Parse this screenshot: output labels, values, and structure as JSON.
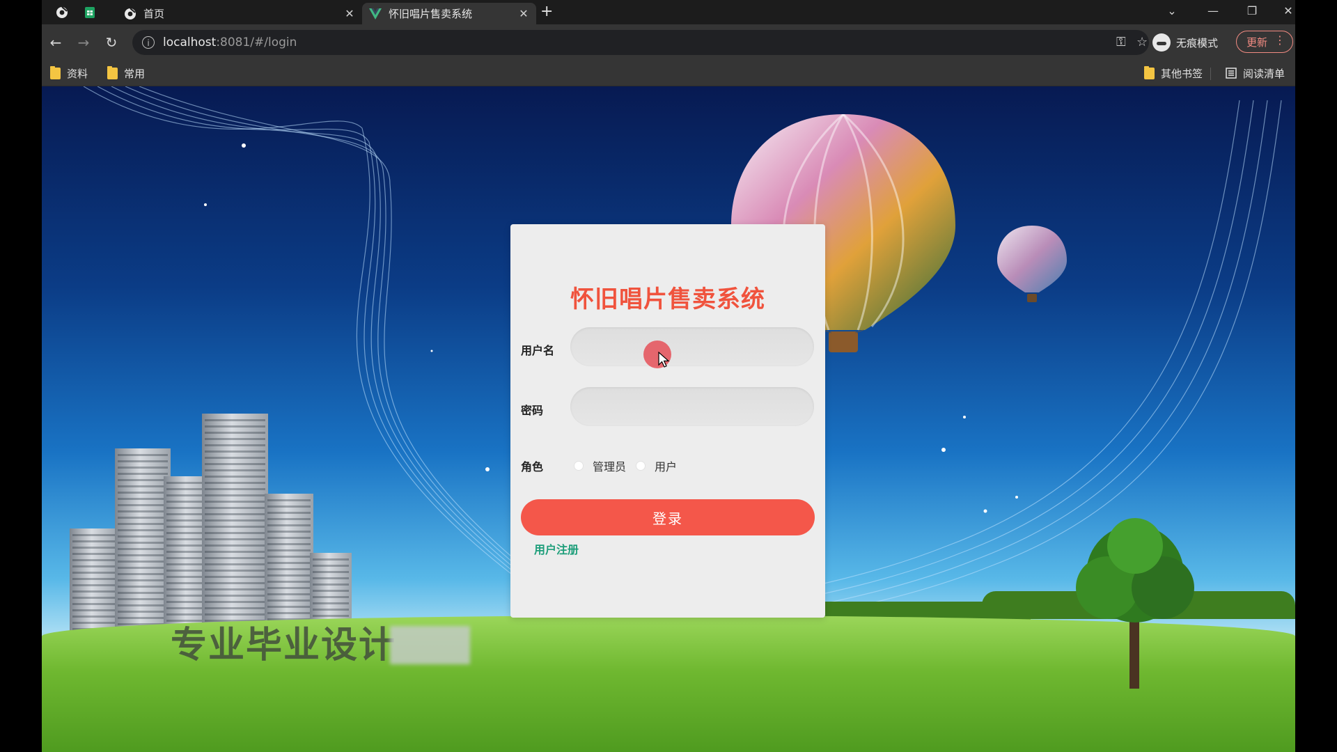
{
  "browser": {
    "tabs": [
      {
        "title": "首页",
        "active": false
      },
      {
        "title": "怀旧唱片售卖系统",
        "active": true
      }
    ],
    "new_tab_label": "+",
    "address": {
      "host": "localhost",
      "port_path": ":8081/#/login"
    },
    "incognito_label": "无痕模式",
    "update_label": "更新",
    "bookmarks": [
      {
        "label": "资料"
      },
      {
        "label": "常用"
      }
    ],
    "other_bookmarks_label": "其他书签",
    "reading_list_label": "阅读清单"
  },
  "login": {
    "title": "怀旧唱片售卖系统",
    "username_label": "用户名",
    "username_value": "",
    "password_label": "密码",
    "password_value": "",
    "role_label": "角色",
    "role_options": [
      {
        "label": "管理员",
        "selected": false
      },
      {
        "label": "用户",
        "selected": false
      }
    ],
    "login_button": "登录",
    "register_link": "用户注册"
  },
  "overlay": {
    "watermark": "专业毕业设计"
  },
  "colors": {
    "title_red": "#f0533d",
    "button_red": "#f4574a",
    "link_green": "#1d9e7a"
  },
  "icons": [
    "chrome-icon",
    "sheets-icon",
    "vue-icon",
    "back-icon",
    "forward-icon",
    "reload-icon",
    "info-icon",
    "key-icon",
    "star-icon",
    "incognito-icon",
    "menu-dots-icon",
    "folder-icon",
    "reading-list-icon"
  ]
}
